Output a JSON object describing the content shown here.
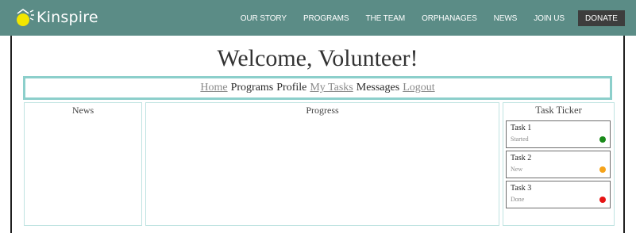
{
  "brand": {
    "name": "Kinspire",
    "icon": "lightbulb-icon",
    "accent": "#5b8c86",
    "icon_color": "#f2e600"
  },
  "topnav": {
    "items": [
      "OUR STORY",
      "PROGRAMS",
      "THE TEAM",
      "ORPHANAGES",
      "NEWS",
      "JOIN US"
    ],
    "donate_label": "DONATE"
  },
  "page": {
    "title": "Welcome, Volunteer!"
  },
  "subnav": {
    "items": [
      {
        "label": "Home",
        "style": "underline"
      },
      {
        "label": "Programs",
        "style": "plain"
      },
      {
        "label": "Profile",
        "style": "plain"
      },
      {
        "label": "My Tasks",
        "style": "underline"
      },
      {
        "label": "Messages",
        "style": "plain"
      },
      {
        "label": "Logout",
        "style": "underline"
      }
    ]
  },
  "panels": {
    "news_title": "News",
    "progress_title": "Progress",
    "ticker_title": "Task Ticker"
  },
  "tasks": [
    {
      "name": "Task 1",
      "status": "Started",
      "color": "#1a8a1a"
    },
    {
      "name": "Task 2",
      "status": "New",
      "color": "#f5a31a"
    },
    {
      "name": "Task 3",
      "status": "Done",
      "color": "#e61414"
    }
  ]
}
